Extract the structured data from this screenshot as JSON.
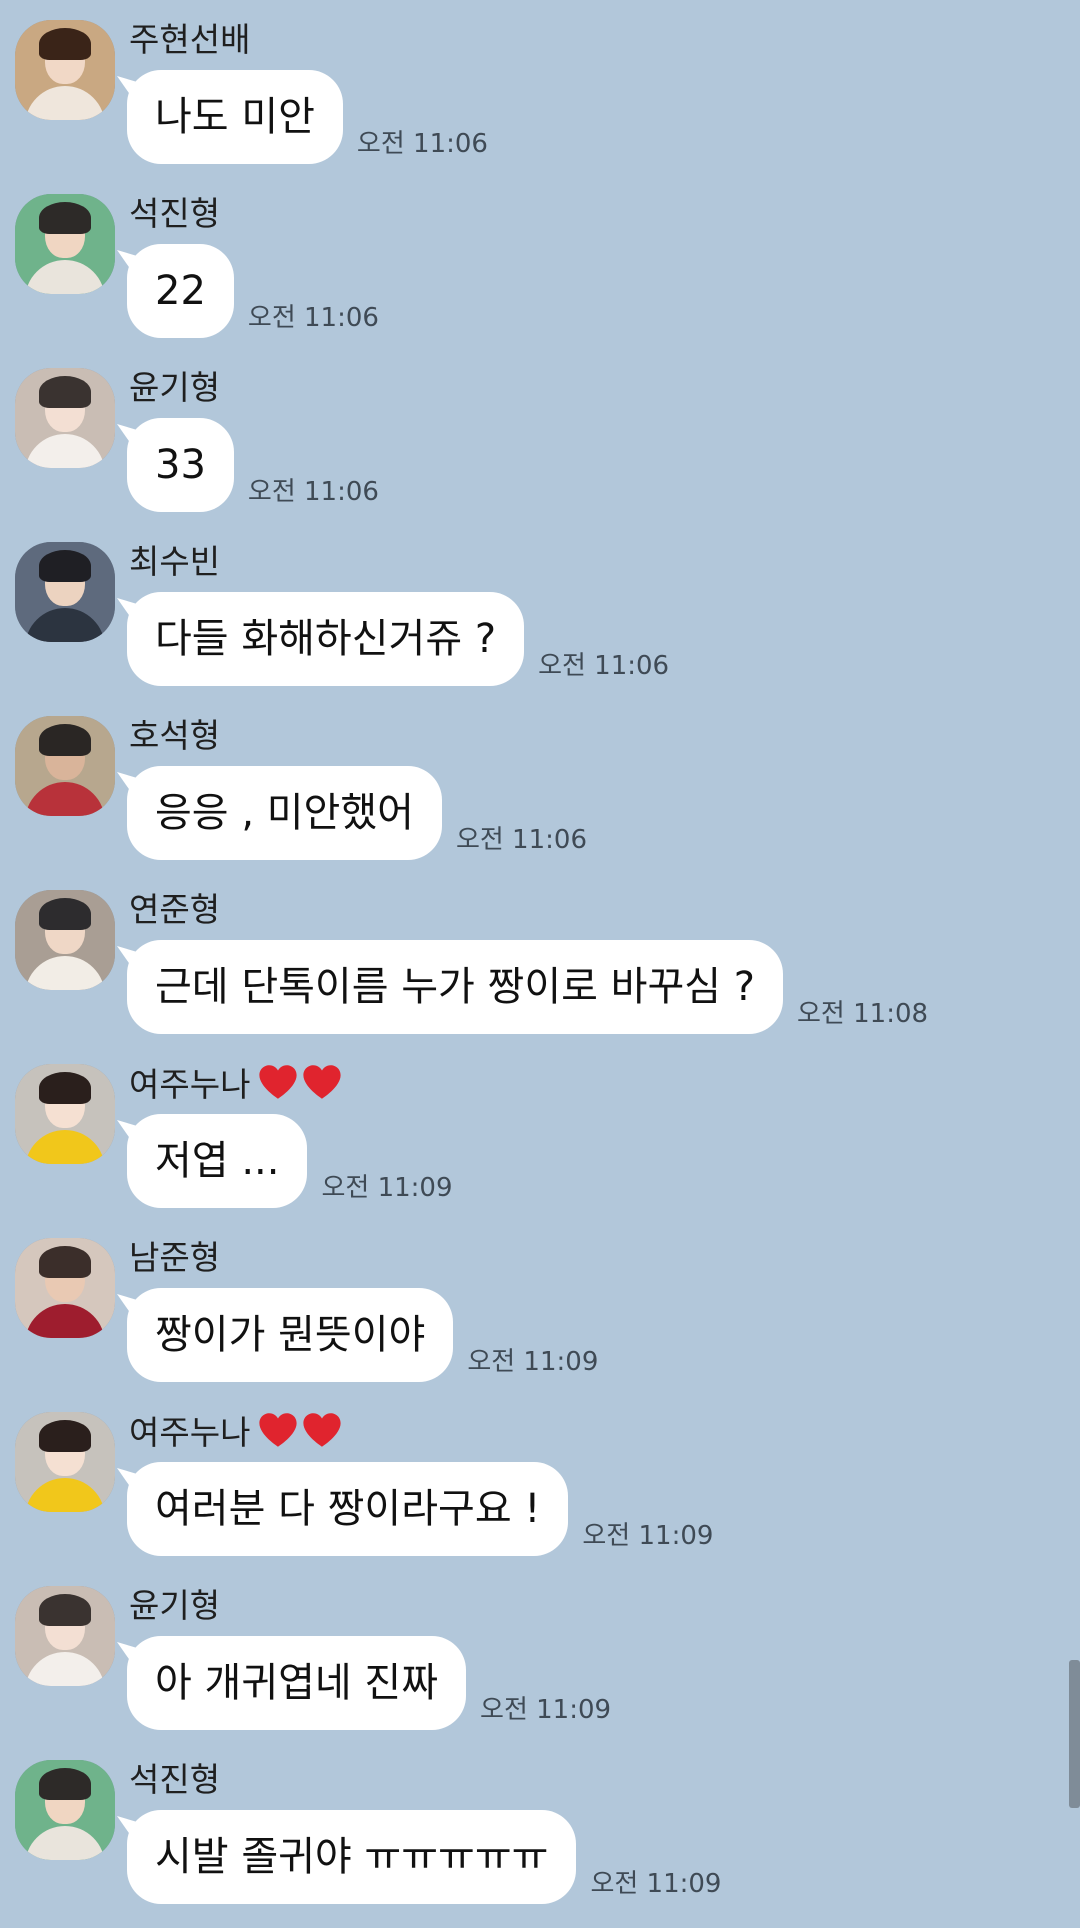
{
  "messages": [
    {
      "sender": "주현선배",
      "hearts": 0,
      "text": "나도 미안",
      "time": "오전 11:06",
      "avatar": {
        "bg": "#c9a882",
        "hair": "#3a2418",
        "shirt": "#efe6dc",
        "skin": "#f1d8c6"
      }
    },
    {
      "sender": "석진형",
      "hearts": 0,
      "text": "22",
      "time": "오전 11:06",
      "avatar": {
        "bg": "#6fb38b",
        "hair": "#2d2a28",
        "shirt": "#e9e4dc",
        "skin": "#f0d6c2"
      }
    },
    {
      "sender": "윤기형",
      "hearts": 0,
      "text": "33",
      "time": "오전 11:06",
      "avatar": {
        "bg": "#c9bdb4",
        "hair": "#3a3330",
        "shirt": "#f3efeb",
        "skin": "#f3dfd3"
      }
    },
    {
      "sender": "최수빈",
      "hearts": 0,
      "text": "다들 화해하신거쥬 ?",
      "time": "오전 11:06",
      "avatar": {
        "bg": "#5e6a7d",
        "hair": "#1f1f24",
        "shirt": "#2c3440",
        "skin": "#ecd3c0"
      }
    },
    {
      "sender": "호석형",
      "hearts": 0,
      "text": "응응 , 미안했어",
      "time": "오전 11:06",
      "avatar": {
        "bg": "#b7a78e",
        "hair": "#2a2624",
        "shirt": "#b8323a",
        "skin": "#d9b49a"
      }
    },
    {
      "sender": "연준형",
      "hearts": 0,
      "text": "근데 단톡이름 누가 짱이로 바꾸심 ?",
      "time": "오전 11:08",
      "avatar": {
        "bg": "#a99e94",
        "hair": "#2d2c2e",
        "shirt": "#f2ede6",
        "skin": "#efd7c6"
      }
    },
    {
      "sender": "여주누나",
      "hearts": 2,
      "text": "저엽 ...",
      "time": "오전 11:09",
      "avatar": {
        "bg": "#c6c2bc",
        "hair": "#2a1f1c",
        "shirt": "#f1c71b",
        "skin": "#f5e0d2"
      }
    },
    {
      "sender": "남준형",
      "hearts": 0,
      "text": "짱이가 뭔뜻이야",
      "time": "오전 11:09",
      "avatar": {
        "bg": "#d5c7bd",
        "hair": "#3b2e2a",
        "shirt": "#9e1d2e",
        "skin": "#e9c9b3"
      }
    },
    {
      "sender": "여주누나",
      "hearts": 2,
      "text": "여러분 다 짱이라구요 !",
      "time": "오전 11:09",
      "avatar": {
        "bg": "#c6c2bc",
        "hair": "#2a1f1c",
        "shirt": "#f1c71b",
        "skin": "#f5e0d2"
      }
    },
    {
      "sender": "윤기형",
      "hearts": 0,
      "text": "아 개귀엽네 진짜",
      "time": "오전 11:09",
      "avatar": {
        "bg": "#c9bdb4",
        "hair": "#3a3330",
        "shirt": "#f3efeb",
        "skin": "#f3dfd3"
      }
    },
    {
      "sender": "석진형",
      "hearts": 0,
      "text": "시발 졸귀야 ㅠㅠㅠㅠㅠ",
      "time": "오전 11:09",
      "avatar": {
        "bg": "#6fb38b",
        "hair": "#2d2a28",
        "shirt": "#e9e4dc",
        "skin": "#f0d6c2"
      }
    }
  ],
  "colors": {
    "background": "#b2c7da",
    "bubble": "#ffffff",
    "heart": "#e0242e",
    "time_text": "#3f4a55"
  }
}
